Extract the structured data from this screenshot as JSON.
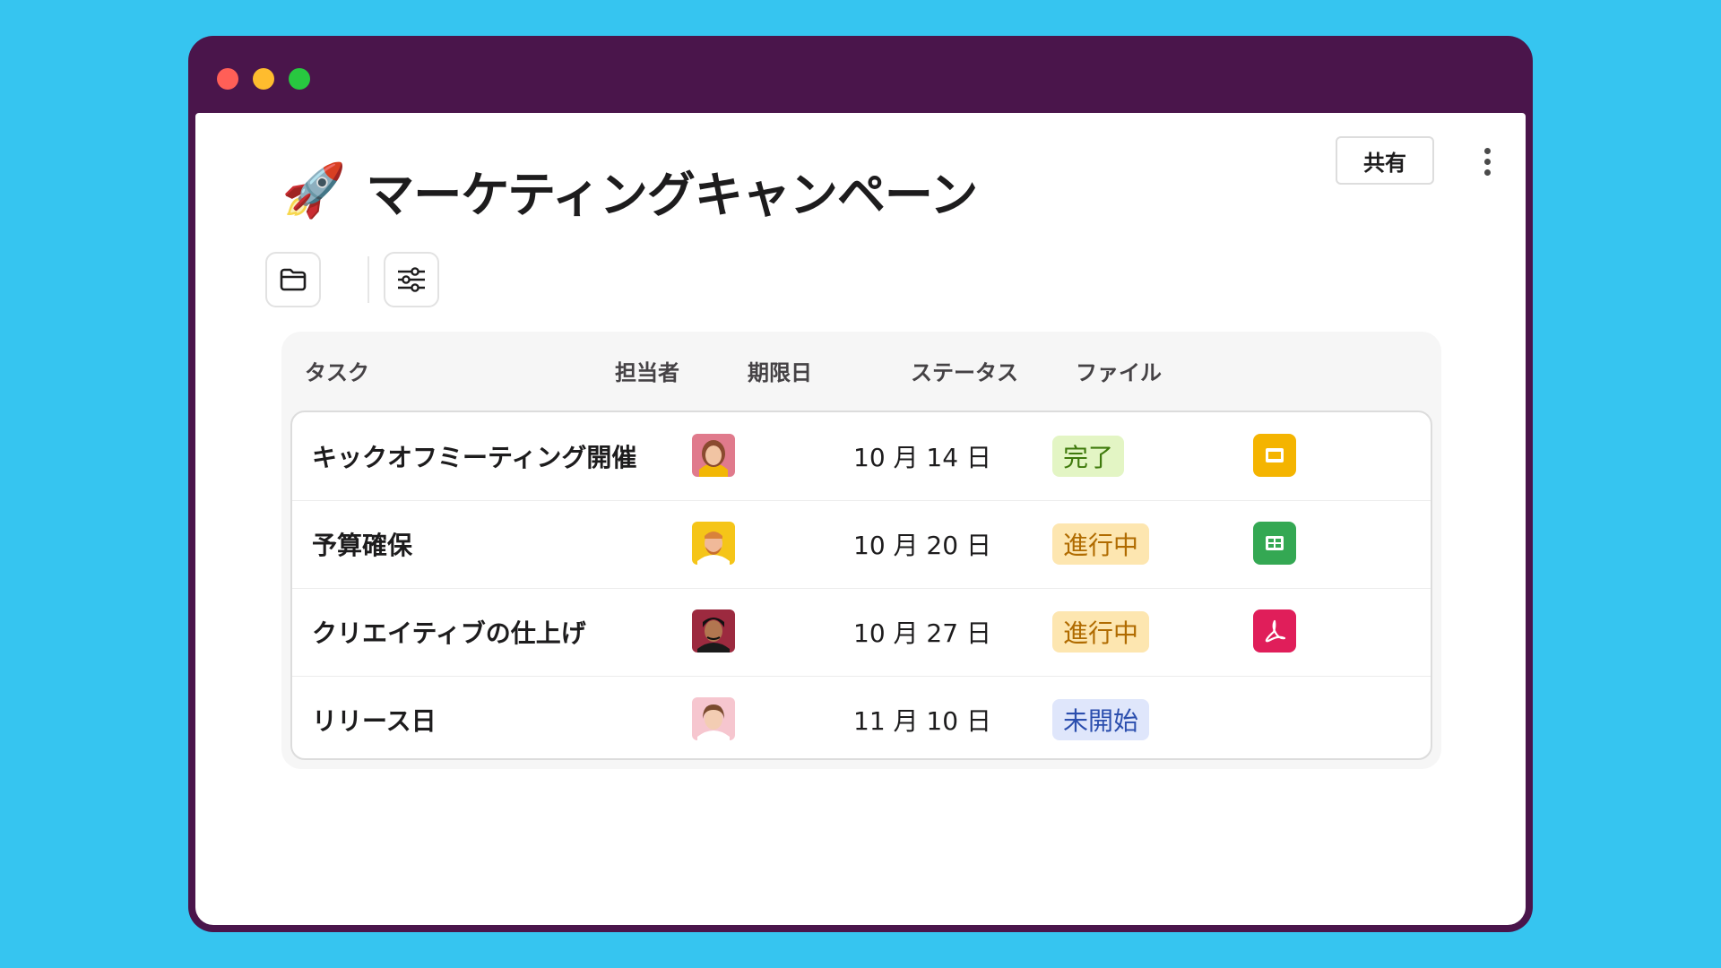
{
  "window": {
    "controls": [
      "close",
      "minimize",
      "maximize"
    ]
  },
  "page": {
    "emoji": "🚀",
    "title": "マーケティングキャンペーン"
  },
  "header": {
    "share_label": "共有",
    "more_icon": "vertical-ellipsis-icon"
  },
  "toolbar": {
    "folder_icon": "folder-icon",
    "filter_icon": "sliders-icon"
  },
  "table": {
    "columns": [
      "タスク",
      "担当者",
      "期限日",
      "ステータス",
      "ファイル"
    ],
    "rows": [
      {
        "task": "キックオフミーティング開催",
        "assignee_icon": "avatar-woman-brown-hair",
        "due": "10 月 14 日",
        "status": "完了",
        "file_icon": "google-slides-icon"
      },
      {
        "task": "予算確保",
        "assignee_icon": "avatar-man-blond-beard",
        "due": "10 月 20 日",
        "status": "進行中",
        "file_icon": "google-sheets-icon"
      },
      {
        "task": "クリエイティブの仕上げ",
        "assignee_icon": "avatar-man-dark-hair",
        "due": "10 月 27 日",
        "status": "進行中",
        "file_icon": "pdf-icon"
      },
      {
        "task": "リリース日",
        "assignee_icon": "avatar-woman-short-hair",
        "due": "11 月 10 日",
        "status": "未開始",
        "file_icon": ""
      }
    ]
  },
  "colors": {
    "background": "#36c5f0",
    "window_frame": "#4a154b",
    "status_done_bg": "#e3f5c4",
    "status_done_fg": "#3f7a0c",
    "status_progress_bg": "#fde6b0",
    "status_progress_fg": "#b06b00",
    "status_notstarted_bg": "#dfe6fb",
    "status_notstarted_fg": "#2b4eae"
  }
}
